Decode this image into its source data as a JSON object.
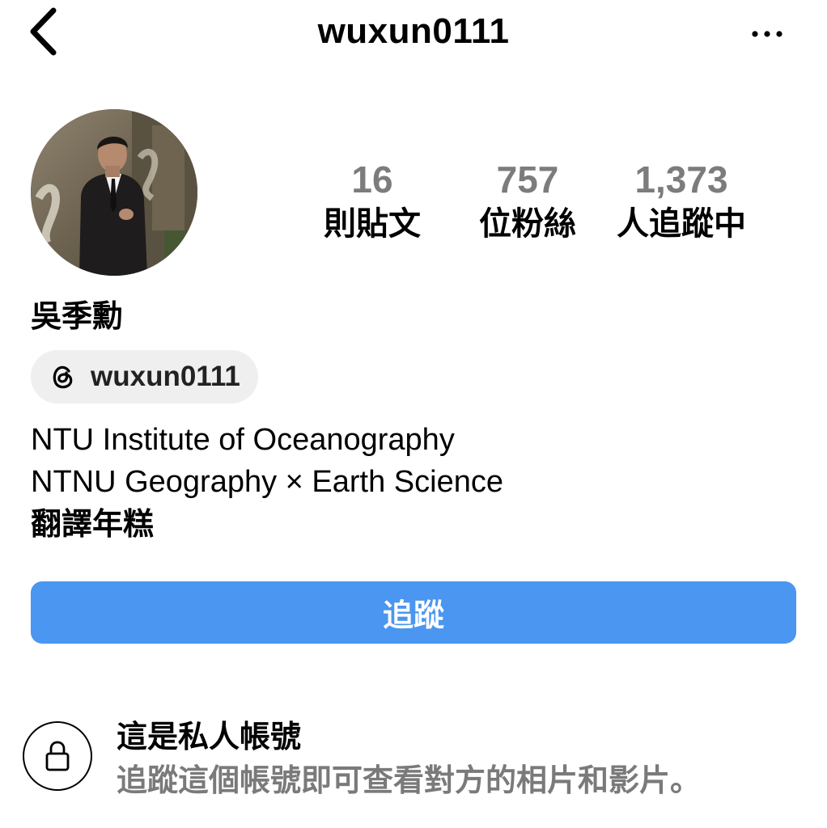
{
  "header": {
    "title": "wuxun0111",
    "back_icon": "chevron-left-icon",
    "more_icon": "more-horizontal-icon"
  },
  "profile": {
    "avatar": "profile-photo",
    "display_name": "吳季勳",
    "stats": {
      "posts": {
        "value": "16",
        "label": "則貼文"
      },
      "followers": {
        "value": "757",
        "label": "位粉絲"
      },
      "following": {
        "value": "1,373",
        "label": "人追蹤中"
      }
    },
    "threads": {
      "icon": "threads-icon",
      "handle": "wuxun0111"
    },
    "bio": [
      "NTU Institute of Oceanography",
      "NTNU Geography × Earth Science",
      "翻譯年糕"
    ]
  },
  "actions": {
    "follow_label": "追蹤",
    "follow_color": "#4a96f0"
  },
  "private_notice": {
    "icon": "lock-icon",
    "title": "這是私人帳號",
    "subtitle": "追蹤這個帳號即可查看對方的相片和影片。"
  }
}
